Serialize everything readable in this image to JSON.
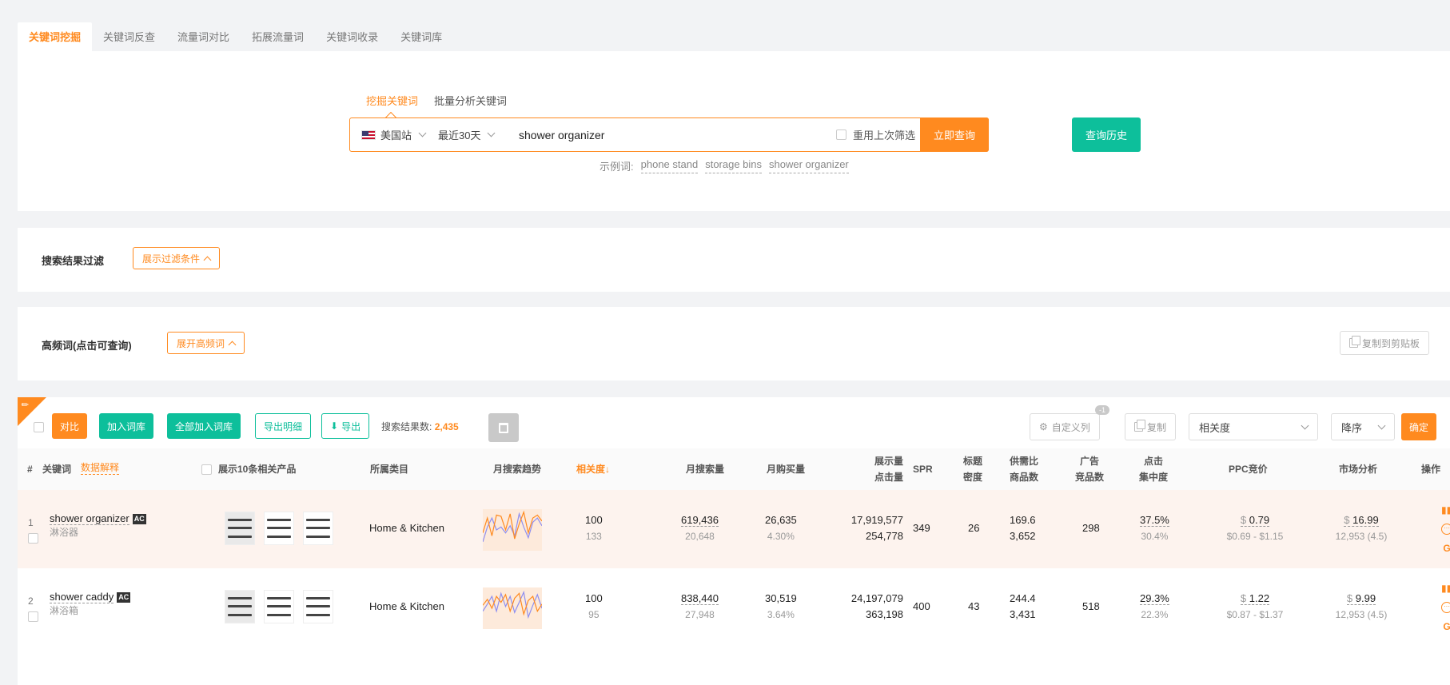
{
  "tabs": [
    "关键词挖掘",
    "关键词反查",
    "流量词对比",
    "拓展流量词",
    "关键词收录",
    "关键词库"
  ],
  "search": {
    "subtabs": [
      "挖掘关键词",
      "批量分析关键词"
    ],
    "site": "美国站",
    "range": "最近30天",
    "query": "shower organizer",
    "reuse_label": "重用上次筛选",
    "query_button": "立即查询",
    "history_button": "查询历史",
    "examples_label": "示例词:",
    "examples": [
      "phone stand",
      "storage bins",
      "shower organizer"
    ]
  },
  "filter": {
    "title": "搜索结果过滤",
    "button": "展示过滤条件"
  },
  "hf": {
    "title": "高频词(点击可查询)",
    "button": "展开高频词",
    "copy_button": "复制到剪贴板"
  },
  "toolbar": {
    "compare": "对比",
    "add_lib": "加入词库",
    "add_all_lib": "全部加入词库",
    "export_detail": "导出明细",
    "export": "导出",
    "count_label": "搜索结果数:",
    "count": "2,435",
    "custom_col": "自定义列",
    "custom_badge": "-1",
    "copy": "复制",
    "sort_field": "相关度",
    "sort_order": "降序",
    "confirm": "确定"
  },
  "table": {
    "headers": {
      "num": "#",
      "keyword": "关键词",
      "explain": "数据解释",
      "show_products": "展示10条相关产品",
      "category": "所属类目",
      "trend": "月搜索趋势",
      "relevance": "相关度↓",
      "monthly_search": "月搜索量",
      "monthly_buy": "月购买量",
      "impressions_1": "展示量",
      "impressions_2": "点击量",
      "spr": "SPR",
      "title_density_1": "标题",
      "title_density_2": "密度",
      "supply_1": "供需比",
      "supply_2": "商品数",
      "ad_1": "广告",
      "ad_2": "竞品数",
      "click_1": "点击",
      "click_2": "集中度",
      "ppc": "PPC竞价",
      "market": "市场分析",
      "ops": "操作"
    },
    "rows": [
      {
        "num": "1",
        "keyword": "shower organizer",
        "badge": "AC",
        "translation": "淋浴器",
        "category": "Home & Kitchen",
        "relevance": "100",
        "relevance_sub": "133",
        "monthly_search": "619,436",
        "monthly_search_sub": "20,648",
        "monthly_buy": "26,635",
        "monthly_buy_sub": "4.30%",
        "impressions": "17,919,577",
        "clicks": "254,778",
        "spr": "349",
        "title_density": "26",
        "supply_ratio": "169.6",
        "products": "3,652",
        "ad_competitors": "298",
        "click_conc": "37.5%",
        "click_conc_sub": "30.4%",
        "ppc": "0.79",
        "ppc_range": "$0.69 - $1.15",
        "market": "16.99",
        "market_sub": "12,953 (4.5)",
        "trend_a": [
          30,
          55,
          25,
          60,
          58,
          35,
          62,
          20,
          45,
          65,
          30,
          55,
          60,
          50
        ],
        "trend_b": [
          15,
          40,
          55,
          35,
          40,
          30,
          42,
          25,
          62,
          40,
          22,
          48,
          55,
          42
        ]
      },
      {
        "num": "2",
        "keyword": "shower caddy",
        "badge": "AC",
        "translation": "淋浴箱",
        "category": "Home & Kitchen",
        "relevance": "100",
        "relevance_sub": "95",
        "monthly_search": "838,440",
        "monthly_search_sub": "27,948",
        "monthly_buy": "30,519",
        "monthly_buy_sub": "3.64%",
        "impressions": "24,197,079",
        "clicks": "363,198",
        "spr": "400",
        "title_density": "43",
        "supply_ratio": "244.4",
        "products": "3,431",
        "ad_competitors": "518",
        "click_conc": "29.3%",
        "click_conc_sub": "22.3%",
        "ppc": "1.22",
        "ppc_range": "$0.87 - $1.37",
        "market": "9.99",
        "market_sub": "12,953 (4.5)",
        "trend_a": [
          40,
          50,
          35,
          55,
          45,
          58,
          30,
          52,
          60,
          25,
          48,
          55,
          30,
          42
        ],
        "trend_b": [
          30,
          42,
          55,
          30,
          60,
          38,
          55,
          28,
          45,
          62,
          20,
          40,
          58,
          35
        ]
      }
    ]
  },
  "colors": {
    "accent": "#ff8a1f",
    "green": "#0dbf9b"
  }
}
